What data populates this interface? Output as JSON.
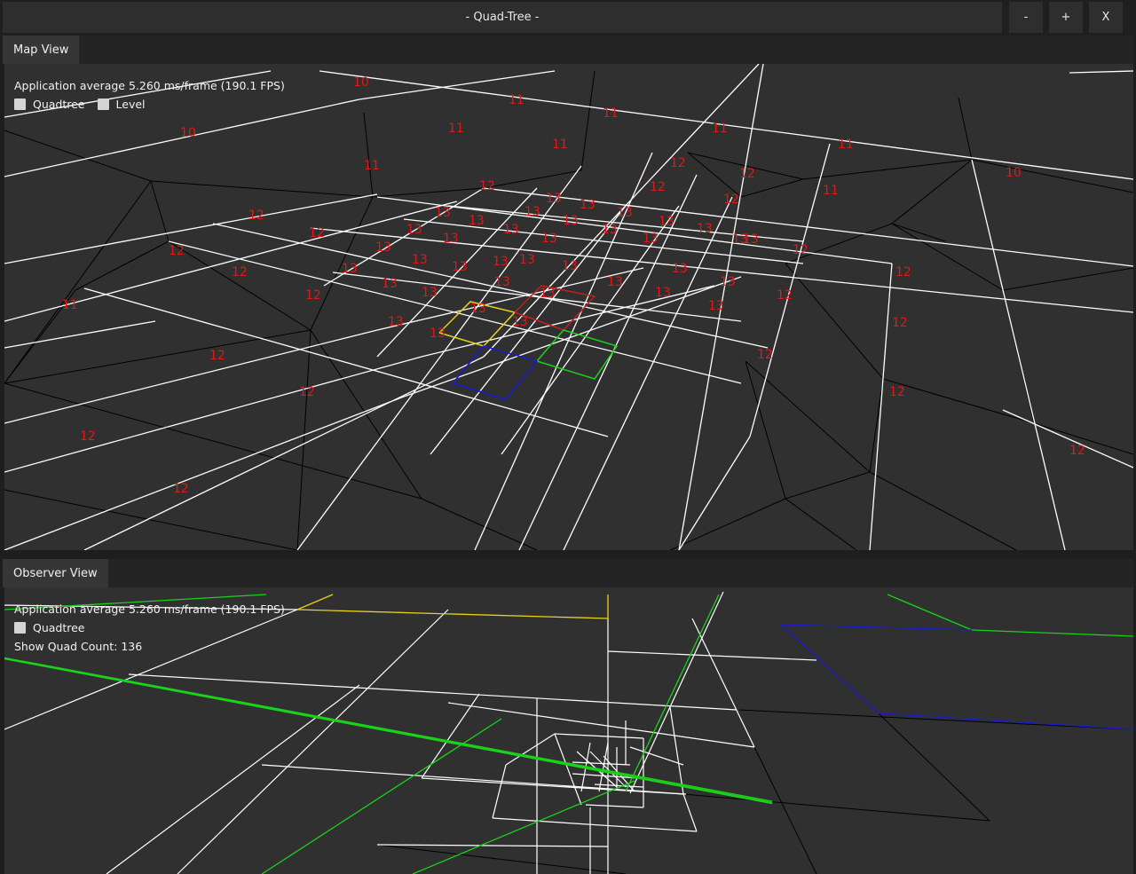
{
  "window": {
    "title": "- Quad-Tree -",
    "buttons": {
      "minimize": "-",
      "maximize": "+",
      "close": "X"
    }
  },
  "map_view": {
    "tab_label": "Map View",
    "fps_text": "Application average 5.260 ms/frame (190.1 FPS)",
    "checkboxes": [
      {
        "label": "Quadtree",
        "checked": false
      },
      {
        "label": "Level",
        "checked": false
      }
    ],
    "level_labels": [
      "10",
      "11",
      "11",
      "10",
      "11",
      "11",
      "11",
      "11",
      "10",
      "11",
      "12",
      "12",
      "12",
      "11",
      "13",
      "13",
      "12",
      "12",
      "13",
      "13",
      "13",
      "13",
      "13",
      "13",
      "13",
      "13",
      "13",
      "13",
      "12",
      "13",
      "13",
      "13",
      "13",
      "13",
      "13",
      "12",
      "11",
      "12",
      "13",
      "13",
      "13",
      "13",
      "13",
      "12",
      "12",
      "13",
      "13",
      "13",
      "13",
      "13",
      "13",
      "12",
      "12",
      "12",
      "13",
      "13",
      "13",
      "13",
      "12",
      "12",
      "12",
      "13",
      "13",
      "13",
      "13",
      "12",
      "12",
      "12",
      "12",
      "12"
    ],
    "colors": {
      "background": "#303030",
      "grid": "#ffffff",
      "mesh": "#000000",
      "label": "#e01818",
      "yellow_quad": "#e8d21a",
      "red_quad": "#c02020",
      "green_quad": "#1ad21a",
      "blue_quad": "#1a1ad2"
    }
  },
  "observer_view": {
    "tab_label": "Observer View",
    "fps_text": "Application average 5.260 ms/frame (190.1 FPS)",
    "checkbox": {
      "label": "Quadtree",
      "checked": false
    },
    "quad_count_text": "Show Quad Count: 136"
  }
}
